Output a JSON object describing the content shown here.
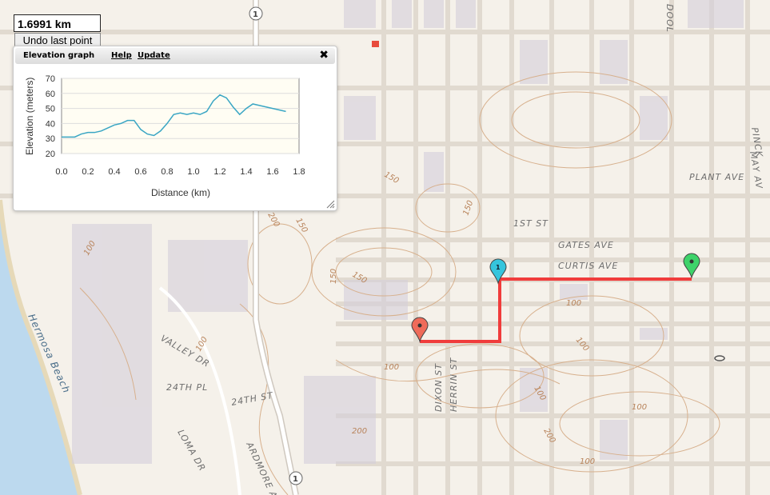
{
  "distance": {
    "value": "1.6991 km"
  },
  "undo": {
    "label": "Undo last point"
  },
  "elevation_panel": {
    "title": "Elevation graph",
    "help_label": "Help",
    "update_label": "Update"
  },
  "map": {
    "street_labels": [
      "PLANT AVE",
      "1ST ST",
      "GATES AVE",
      "CURTIS AVE",
      "VALLEY DR",
      "24TH PL",
      "24TH ST",
      "LOMA DR",
      "ARDMORE A",
      "DIXON ST",
      "HERRIN ST",
      "PINCK",
      "MAY AV",
      "DOOL",
      "Hermosa Beach"
    ],
    "contour_labels": [
      "150",
      "150",
      "150",
      "150",
      "200",
      "150",
      "100",
      "100",
      "100",
      "100",
      "100",
      "100",
      "200",
      "200",
      "100",
      "100"
    ],
    "route_shields": [
      "1",
      "1"
    ],
    "route_color": "#f03c3c",
    "marker_labels": [
      "1"
    ],
    "start_marker_color": "#ef6b5a",
    "waypoint_marker_color": "#35c5dd",
    "end_marker_color": "#3ed36a"
  },
  "chart_data": {
    "type": "line",
    "title": "",
    "xlabel": "Distance (km)",
    "ylabel": "Elevation (meters)",
    "xlim": [
      0,
      1.8
    ],
    "ylim": [
      20,
      70
    ],
    "xticks": [
      "0.0",
      "0.2",
      "0.4",
      "0.6",
      "0.8",
      "1.0",
      "1.2",
      "1.4",
      "1.6",
      "1.8"
    ],
    "yticks": [
      "20",
      "30",
      "40",
      "50",
      "60",
      "70"
    ],
    "color": "#3aa6c4",
    "x": [
      0.0,
      0.05,
      0.1,
      0.15,
      0.2,
      0.25,
      0.3,
      0.35,
      0.4,
      0.45,
      0.5,
      0.55,
      0.6,
      0.65,
      0.7,
      0.75,
      0.8,
      0.85,
      0.9,
      0.95,
      1.0,
      1.05,
      1.1,
      1.15,
      1.2,
      1.25,
      1.3,
      1.35,
      1.4,
      1.45,
      1.5,
      1.55,
      1.6,
      1.65,
      1.7
    ],
    "y": [
      31,
      31,
      31,
      33,
      34,
      34,
      35,
      37,
      39,
      40,
      42,
      42,
      36,
      33,
      32,
      35,
      40,
      46,
      47,
      46,
      47,
      46,
      48,
      55,
      59,
      57,
      51,
      46,
      50,
      53,
      52,
      51,
      50,
      49,
      48
    ]
  }
}
